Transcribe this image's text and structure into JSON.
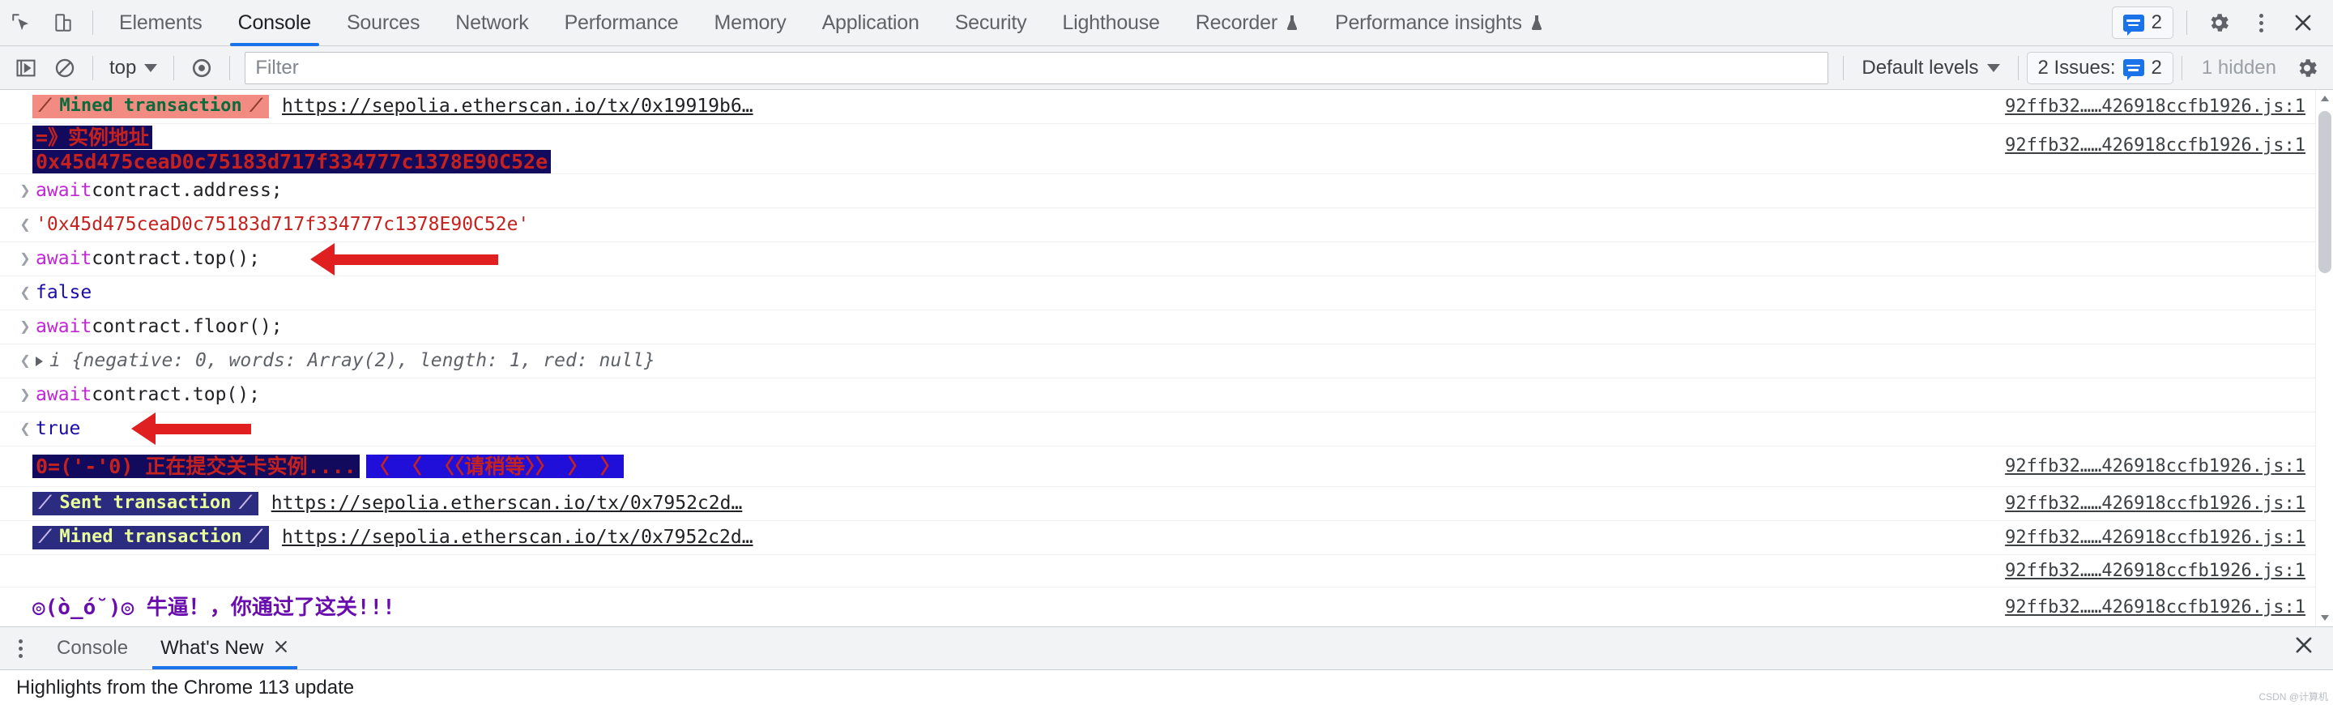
{
  "devtools": {
    "panel_tabs": [
      {
        "label": "Elements",
        "active": false,
        "experimental": false
      },
      {
        "label": "Console",
        "active": true,
        "experimental": false
      },
      {
        "label": "Sources",
        "active": false,
        "experimental": false
      },
      {
        "label": "Network",
        "active": false,
        "experimental": false
      },
      {
        "label": "Performance",
        "active": false,
        "experimental": false
      },
      {
        "label": "Memory",
        "active": false,
        "experimental": false
      },
      {
        "label": "Application",
        "active": false,
        "experimental": false
      },
      {
        "label": "Security",
        "active": false,
        "experimental": false
      },
      {
        "label": "Lighthouse",
        "active": false,
        "experimental": false
      },
      {
        "label": "Recorder",
        "active": false,
        "experimental": true
      },
      {
        "label": "Performance insights",
        "active": false,
        "experimental": true
      }
    ],
    "topbar_right": {
      "issues_count": "2",
      "settings_icon": "gear-icon",
      "more_icon": "more-vertical-icon",
      "close_icon": "close-icon",
      "inspect_icon": "inspect-element-icon",
      "device_icon": "device-toolbar-icon"
    },
    "filterbar": {
      "execute_icon": "execute-snippet-icon",
      "clear_icon": "clear-console-icon",
      "context": "top",
      "eye_icon": "live-expression-icon",
      "filter_placeholder": "Filter",
      "filter_value": "",
      "levels_label": "Default levels",
      "issues_label": "2 Issues:",
      "issues_badge": "2",
      "hidden_label": "1 hidden",
      "settings_icon": "console-settings-gear-icon"
    }
  },
  "console_messages": [
    {
      "id": "m1",
      "type": "styled-banner",
      "chip_style": "salmon",
      "chip_text": "Mined transaction",
      "link": "https://sepolia.etherscan.io/tx/0x19919b6…",
      "source": "92ffb32……426918ccfb1926.js:1"
    },
    {
      "id": "m2",
      "type": "styled-two-line",
      "line1": "=》实例地址",
      "line2": "0x45d475ceaD0c75183d717f334777c1378E90C52e",
      "source": "92ffb32……426918ccfb1926.js:1"
    },
    {
      "id": "m3",
      "type": "input",
      "keyword": "await",
      "rest": " contract.address;"
    },
    {
      "id": "m4",
      "type": "output-string",
      "value": "'0x45d475ceaD0c75183d717f334777c1378E90C52e'"
    },
    {
      "id": "m5",
      "type": "input",
      "keyword": "await",
      "rest": " contract.top();",
      "annotated": true
    },
    {
      "id": "m6",
      "type": "output-bool",
      "value": "false"
    },
    {
      "id": "m7",
      "type": "input",
      "keyword": "await",
      "rest": " contract.floor();"
    },
    {
      "id": "m8",
      "type": "output-object",
      "prefix": "i ",
      "parts": [
        {
          "k": "{negative: ",
          "v": "0"
        },
        {
          "k": ", words: ",
          "v": "Array(2)"
        },
        {
          "k": ", length: ",
          "v": "1"
        },
        {
          "k": ", red: ",
          "v": "null"
        }
      ],
      "tail": "}",
      "value": "i {negative: 0, words: Array(2), length: 1, red: null}"
    },
    {
      "id": "m9",
      "type": "input",
      "keyword": "await",
      "rest": " contract.top();",
      "annotated": true
    },
    {
      "id": "m10",
      "type": "output-bool",
      "value": "true"
    },
    {
      "id": "m11",
      "type": "styled-submit",
      "text_dark": "0=('-'0) 正在提交关卡实例....",
      "text_blue": "〈 〈 〈〈请稍等〉〉 〉 〉",
      "source": "92ffb32……426918ccfb1926.js:1"
    },
    {
      "id": "m12",
      "type": "styled-banner",
      "chip_style": "navy",
      "chip_text": "Sent transaction",
      "link": "https://sepolia.etherscan.io/tx/0x7952c2d…",
      "source": "92ffb32……426918ccfb1926.js:1"
    },
    {
      "id": "m13",
      "type": "styled-banner",
      "chip_style": "navy",
      "chip_text": "Mined transaction",
      "link": "https://sepolia.etherscan.io/tx/0x7952c2d…",
      "source": "92ffb32……426918ccfb1926.js:1"
    },
    {
      "id": "m14",
      "type": "blank",
      "source": "92ffb32……426918ccfb1926.js:1"
    },
    {
      "id": "m15",
      "type": "styled-congrats",
      "text": "◎(ò_ó˘)◎ 牛逼！，你通过了这关!!!",
      "source": "92ffb32……426918ccfb1926.js:1"
    }
  ],
  "drawer": {
    "more_icon": "drawer-more-icon",
    "tabs": [
      {
        "label": "Console",
        "active": false,
        "closable": false
      },
      {
        "label": "What's New",
        "active": true,
        "closable": true
      }
    ],
    "close_icon": "drawer-close-icon",
    "content_text": "Highlights from the Chrome 113 update"
  },
  "colors": {
    "accent": "#1a73e8",
    "toolbar_bg": "#f1f3f4",
    "border": "#cdd1d4",
    "arrow_red": "#e02020",
    "keyword_purple": "#c026d3",
    "string_red": "#c5221f",
    "bool_blue": "#1a0dab",
    "chip_salmon": "#f28b82",
    "chip_navy": "#2b2b80"
  },
  "watermark": "CSDN @计算机"
}
